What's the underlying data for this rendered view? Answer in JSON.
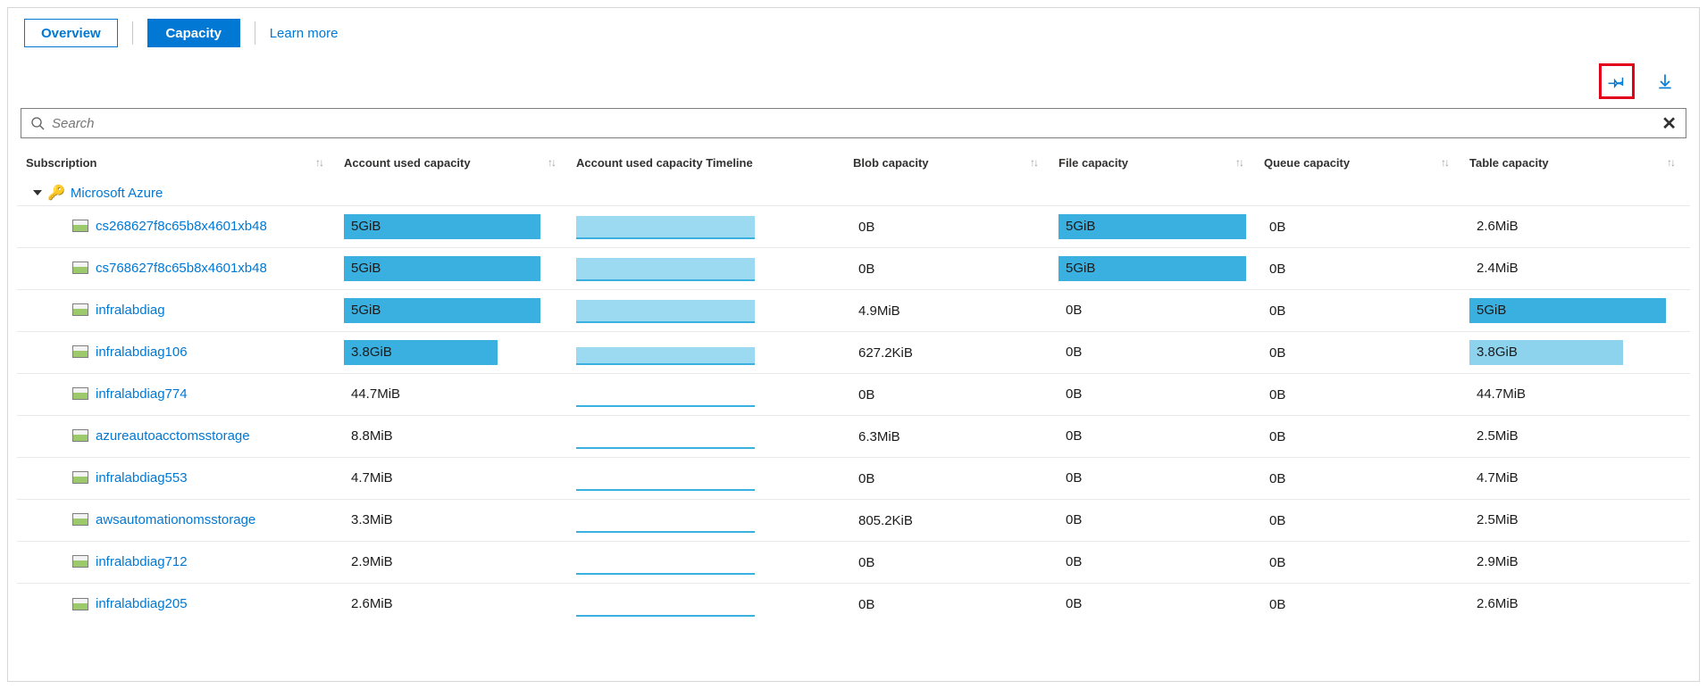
{
  "toolbar": {
    "overview": "Overview",
    "capacity": "Capacity",
    "learn_more": "Learn more"
  },
  "actions": {
    "pin": "pin",
    "download": "download"
  },
  "search": {
    "placeholder": "Search"
  },
  "columns": {
    "subscription": "Subscription",
    "account_used": "Account used capacity",
    "timeline": "Account used capacity Timeline",
    "blob": "Blob capacity",
    "file": "File capacity",
    "queue": "Queue capacity",
    "table": "Table capacity"
  },
  "group": {
    "label": "Microsoft Azure"
  },
  "rows": [
    {
      "name": "cs268627f8c65b8x4601xb48",
      "used": "5GiB",
      "used_pct": 100,
      "tl_pct": 100,
      "blob": "0B",
      "file": "5GiB",
      "file_pct": 100,
      "queue": "0B",
      "table": "2.6MiB",
      "table_pct": 0
    },
    {
      "name": "cs768627f8c65b8x4601xb48",
      "used": "5GiB",
      "used_pct": 100,
      "tl_pct": 100,
      "blob": "0B",
      "file": "5GiB",
      "file_pct": 100,
      "queue": "0B",
      "table": "2.4MiB",
      "table_pct": 0
    },
    {
      "name": "infralabdiag",
      "used": "5GiB",
      "used_pct": 100,
      "tl_pct": 100,
      "blob": "4.9MiB",
      "file": "0B",
      "file_pct": 0,
      "queue": "0B",
      "table": "5GiB",
      "table_pct": 100
    },
    {
      "name": "infralabdiag106",
      "used": "3.8GiB",
      "used_pct": 78,
      "tl_pct": 78,
      "blob": "627.2KiB",
      "file": "0B",
      "file_pct": 0,
      "queue": "0B",
      "table": "3.8GiB",
      "table_pct": 78,
      "table_light": true
    },
    {
      "name": "infralabdiag774",
      "used": "44.7MiB",
      "used_pct": 0,
      "tl_pct": 3,
      "blob": "0B",
      "file": "0B",
      "file_pct": 0,
      "queue": "0B",
      "table": "44.7MiB",
      "table_pct": 0
    },
    {
      "name": "azureautoacctomsstorage",
      "used": "8.8MiB",
      "used_pct": 0,
      "tl_pct": 2,
      "blob": "6.3MiB",
      "file": "0B",
      "file_pct": 0,
      "queue": "0B",
      "table": "2.5MiB",
      "table_pct": 0
    },
    {
      "name": "infralabdiag553",
      "used": "4.7MiB",
      "used_pct": 0,
      "tl_pct": 2,
      "blob": "0B",
      "file": "0B",
      "file_pct": 0,
      "queue": "0B",
      "table": "4.7MiB",
      "table_pct": 0
    },
    {
      "name": "awsautomationomsstorage",
      "used": "3.3MiB",
      "used_pct": 0,
      "tl_pct": 2,
      "blob": "805.2KiB",
      "file": "0B",
      "file_pct": 0,
      "queue": "0B",
      "table": "2.5MiB",
      "table_pct": 0
    },
    {
      "name": "infralabdiag712",
      "used": "2.9MiB",
      "used_pct": 0,
      "tl_pct": 2,
      "blob": "0B",
      "file": "0B",
      "file_pct": 0,
      "queue": "0B",
      "table": "2.9MiB",
      "table_pct": 0
    },
    {
      "name": "infralabdiag205",
      "used": "2.6MiB",
      "used_pct": 0,
      "tl_pct": 2,
      "blob": "0B",
      "file": "0B",
      "file_pct": 0,
      "queue": "0B",
      "table": "2.6MiB",
      "table_pct": 0
    }
  ]
}
